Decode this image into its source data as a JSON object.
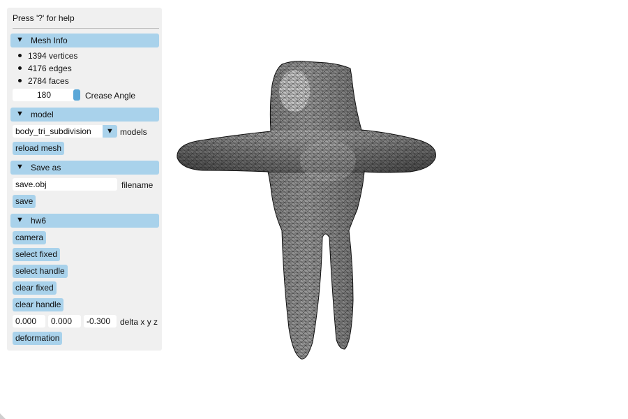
{
  "help_text": "Press '?' for help",
  "mesh_info": {
    "title": "Mesh Info",
    "vertices": "1394 vertices",
    "edges": "4176 edges",
    "faces": "2784 faces",
    "crease_angle_value": "180",
    "crease_angle_label": "Crease Angle"
  },
  "model": {
    "title": "model",
    "selected": "body_tri_subdivision",
    "select_label": "models",
    "reload_label": "reload mesh"
  },
  "save_as": {
    "title": "Save as",
    "filename_value": "save.obj",
    "filename_label": "filename",
    "save_label": "save"
  },
  "hw6": {
    "title": "hw6",
    "camera_label": "camera",
    "select_fixed_label": "select fixed",
    "select_handle_label": "select handle",
    "clear_fixed_label": "clear fixed",
    "clear_handle_label": "clear handle",
    "dx": "0.000",
    "dy": "0.000",
    "dz": "-0.300",
    "delta_label": "delta x y z",
    "deformation_label": "deformation"
  },
  "icons": {
    "collapse_arrow": "triangle-down-icon",
    "dropdown_arrow": "triangle-down-icon"
  },
  "colors": {
    "panel_bg": "#f0f0f0",
    "header_bg": "#a9d2eb",
    "button_bg": "#a9d2eb",
    "slider_grab": "#5aa7d8",
    "mesh_fill": "#8a8a8a"
  }
}
